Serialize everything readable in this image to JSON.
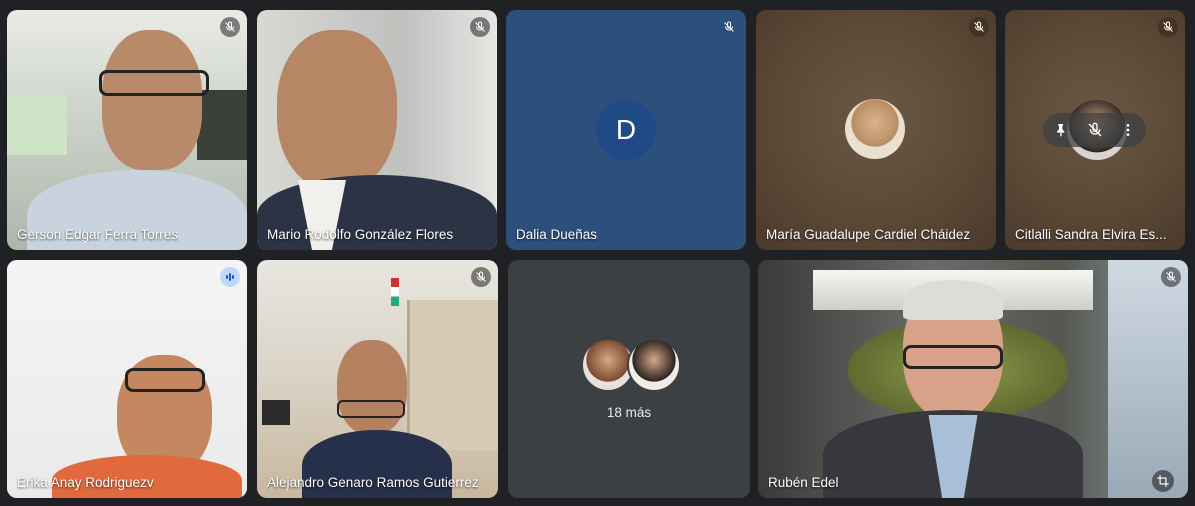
{
  "participants": [
    {
      "name": "Gerson Edgar Ferra Torres",
      "muted": true
    },
    {
      "name": "Mario Rodolfo González Flores",
      "muted": true
    },
    {
      "name": "Dalia Dueñas",
      "muted": true,
      "initial": "D"
    },
    {
      "name": "María Guadalupe Cardiel Cháidez",
      "muted": true
    },
    {
      "name": "Citlalli Sandra Elvira Es...",
      "muted": true
    },
    {
      "name": "Erika Anay Rodriguezv",
      "muted": false,
      "speaking": true
    },
    {
      "name": "Alejandro Genaro Ramos Gutierrez",
      "muted": true
    },
    {
      "name": "Rubén Edel",
      "muted": true
    }
  ],
  "more": {
    "label": "18 más"
  },
  "icons": {
    "mic_off": "mic-off-icon",
    "speaking": "audio-level-icon",
    "pin": "pin-icon",
    "more": "more-vert-icon",
    "crop": "crop-icon"
  },
  "colors": {
    "background": "#202124",
    "tile": "#3c4043",
    "dalia_tile": "#2c4f7c",
    "avatar_d": "#1f4a86",
    "speaking_border": "#a8c7fa"
  }
}
